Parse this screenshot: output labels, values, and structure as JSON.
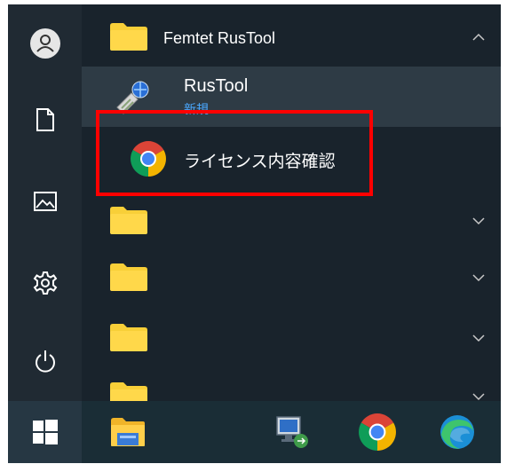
{
  "menu": {
    "group": {
      "name": "Femtet RusTool",
      "expanded": true
    },
    "app": {
      "name": "RusTool",
      "badge": "新規"
    },
    "selected_item": {
      "label": "ライセンス内容確認"
    },
    "collapsed_folders": 4
  },
  "rail": {
    "items": [
      "user-icon",
      "documents-icon",
      "pictures-icon",
      "settings-icon",
      "power-icon"
    ]
  },
  "taskbar": {
    "items": [
      "windows-start-icon",
      "file-explorer-icon",
      "remote-desktop-icon",
      "chrome-icon",
      "edge-icon"
    ]
  },
  "colors": {
    "accent": "#4aa8ff",
    "highlight": "#ff0000",
    "folder": "#f8cf38"
  }
}
